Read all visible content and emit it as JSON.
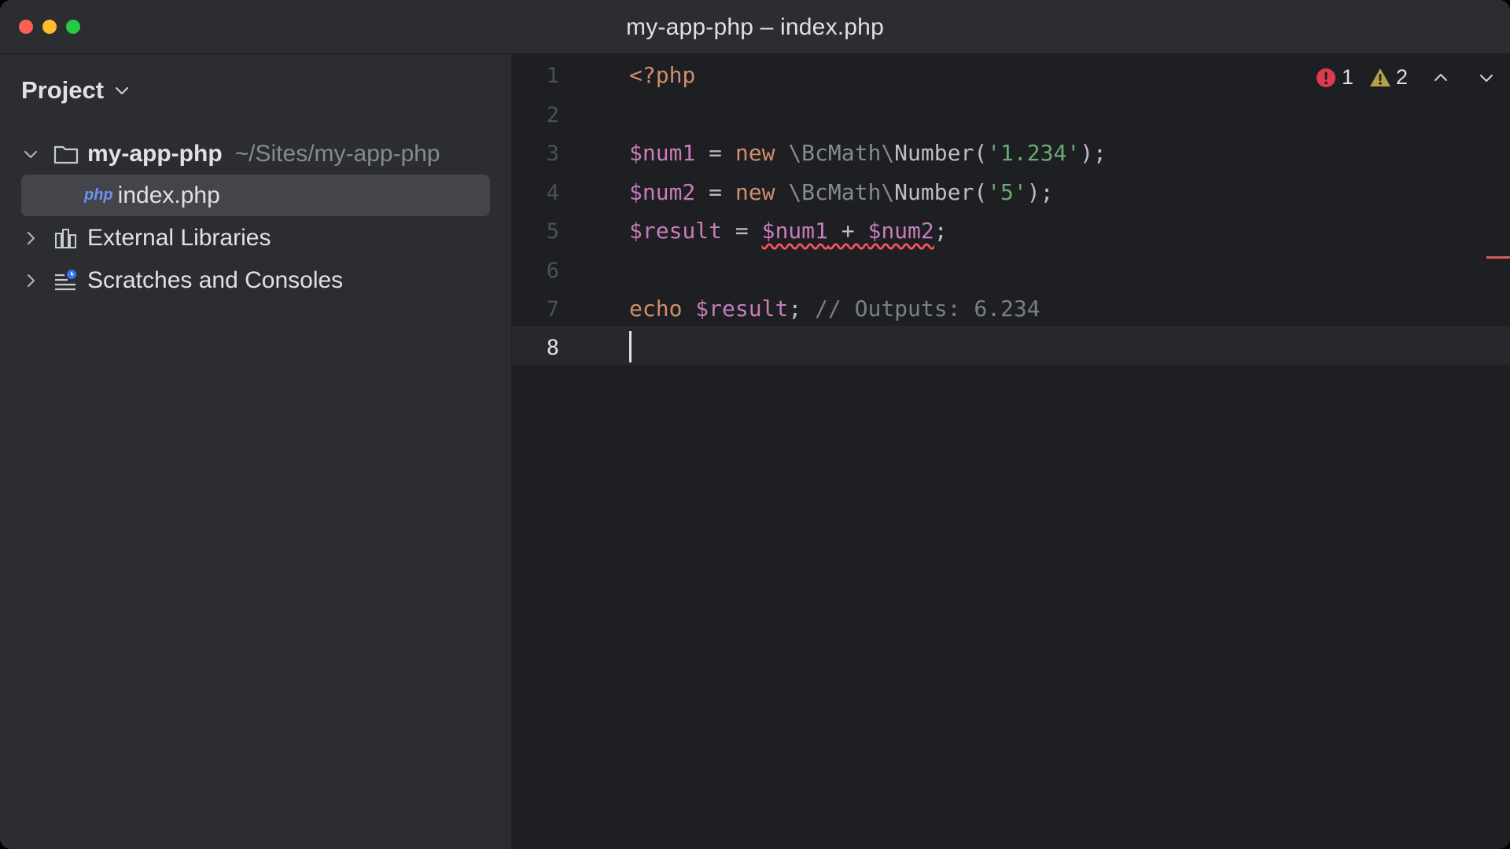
{
  "window": {
    "title": "my-app-php – index.php"
  },
  "sidebar": {
    "header": "Project",
    "tree": [
      {
        "label": "my-app-php",
        "path": "~/Sites/my-app-php",
        "icon": "folder-icon",
        "expanded": true
      },
      {
        "label": "index.php",
        "badge": "php",
        "icon": "php-file-icon",
        "selected": true
      },
      {
        "label": "External Libraries",
        "icon": "library-icon",
        "expanded": false
      },
      {
        "label": "Scratches and Consoles",
        "icon": "scratches-icon",
        "expanded": false
      }
    ]
  },
  "editor": {
    "inspections": {
      "errors": "1",
      "warnings": "2"
    },
    "line_numbers": [
      "1",
      "2",
      "3",
      "4",
      "5",
      "6",
      "7",
      "8"
    ],
    "current_line": "8",
    "code": {
      "l1": "<?php",
      "l3": {
        "var": "$num1",
        "eq": " = ",
        "kw": "new",
        "sp": " ",
        "ns1": "\\BcMath\\",
        "cls": "Number(",
        "str": "'1.234'",
        "end": ");"
      },
      "l4": {
        "var": "$num2",
        "eq": " = ",
        "kw": "new",
        "sp": " ",
        "ns1": "\\BcMath\\",
        "cls": "Number(",
        "str": "'5'",
        "end": ");"
      },
      "l5": {
        "var": "$result",
        "eq": " = ",
        "a": "$num1",
        "op": " + ",
        "b": "$num2",
        "end": ";"
      },
      "l7": {
        "kw": "echo",
        "sp": " ",
        "var": "$result",
        "semi": "; ",
        "comment": "// Outputs: 6.234"
      }
    }
  },
  "colors": {
    "keyword": "#cf8e6d",
    "variable": "#c77dbb",
    "string": "#6aab73",
    "comment": "#7a7e85",
    "error": "#db5c5c",
    "warning": "#b5a14a"
  }
}
